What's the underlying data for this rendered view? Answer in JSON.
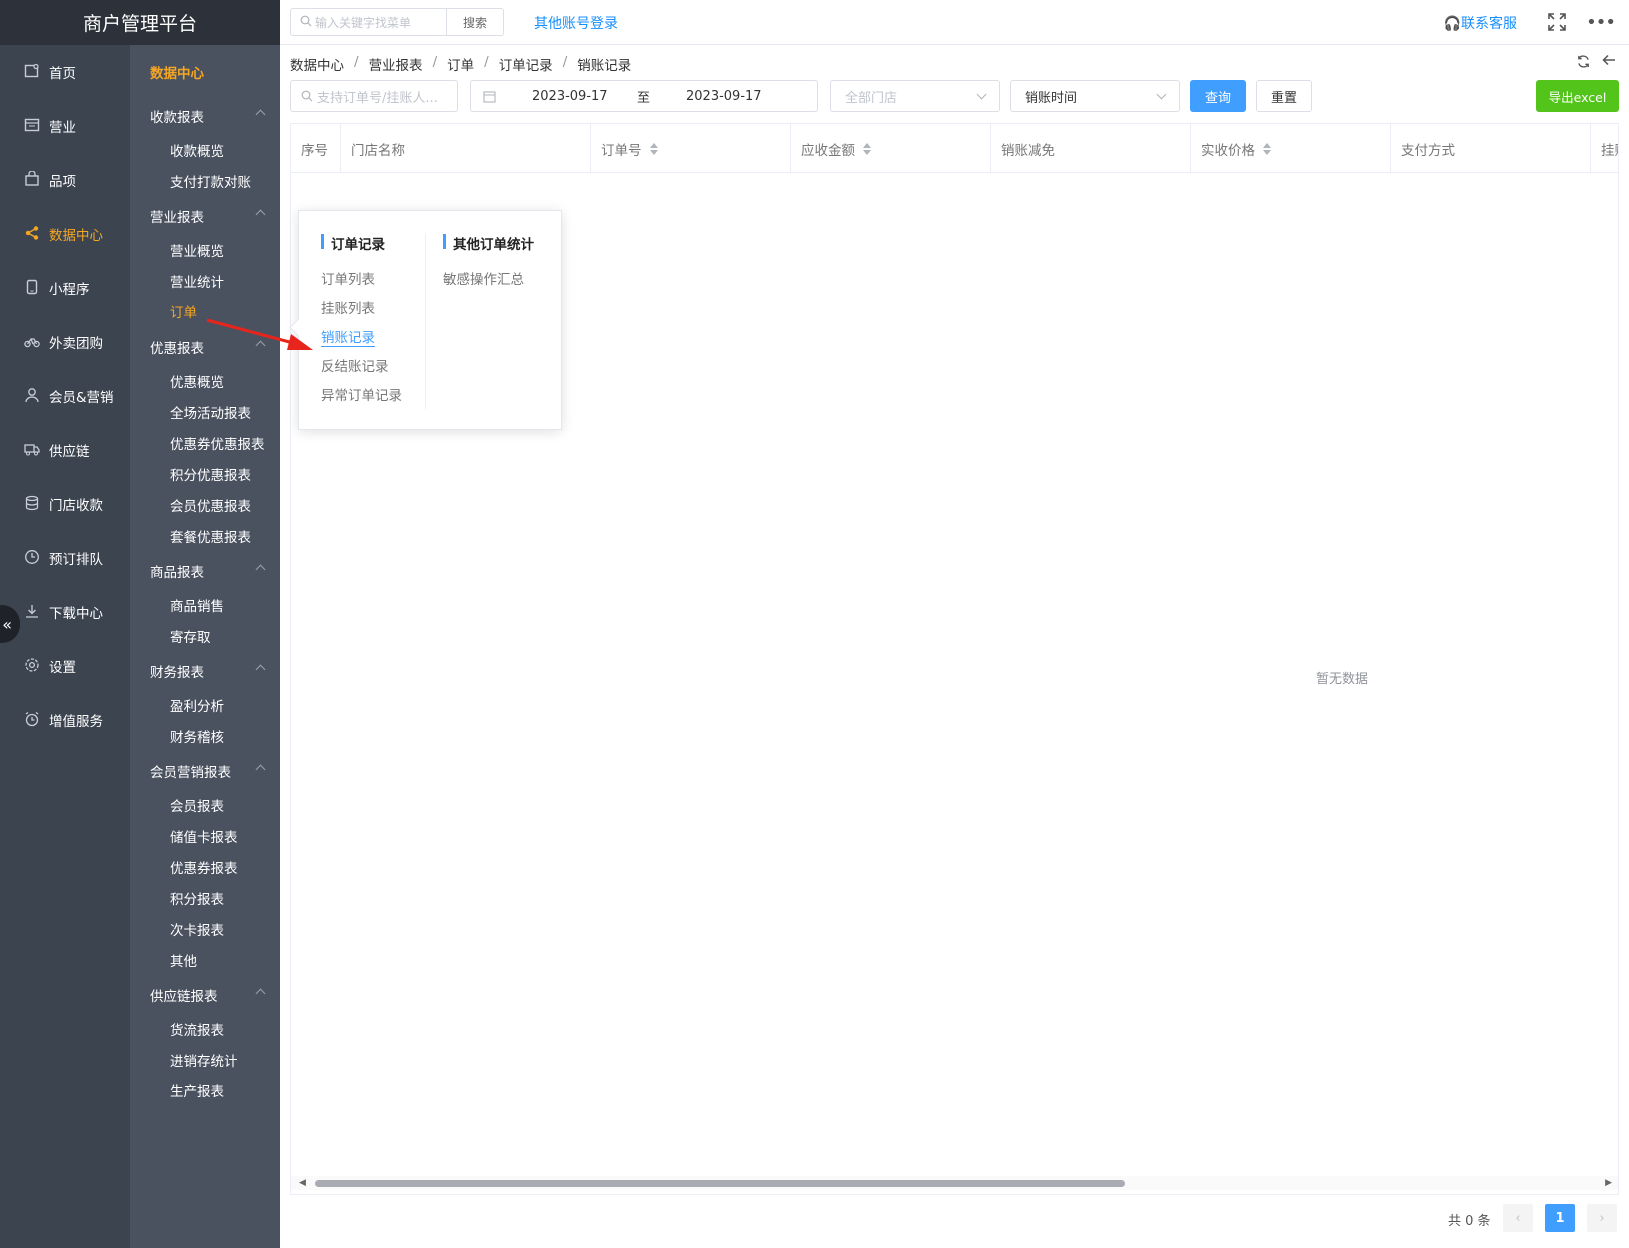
{
  "brand": "商户管理平台",
  "topbar": {
    "search_placeholder": "输入关键字找菜单",
    "search_button": "搜索",
    "other_login": "其他账号登录",
    "contact": "联系客服"
  },
  "nav": [
    {
      "label": "首页",
      "icon": "home-icon"
    },
    {
      "label": "营业",
      "icon": "calendar-icon"
    },
    {
      "label": "品项",
      "icon": "bag-icon"
    },
    {
      "label": "数据中心",
      "icon": "share-icon",
      "active": true
    },
    {
      "label": "小程序",
      "icon": "phone-icon"
    },
    {
      "label": "外卖团购",
      "icon": "bike-icon"
    },
    {
      "label": "会员&营销",
      "icon": "user-icon"
    },
    {
      "label": "供应链",
      "icon": "truck-icon"
    },
    {
      "label": "门店收款",
      "icon": "database-icon"
    },
    {
      "label": "预订排队",
      "icon": "clock-icon"
    },
    {
      "label": "下载中心",
      "icon": "download-icon"
    },
    {
      "label": "设置",
      "icon": "gear-icon"
    },
    {
      "label": "增值服务",
      "icon": "alarm-icon"
    }
  ],
  "subnav": {
    "title": "数据中心",
    "sections": [
      {
        "title": "收款报表",
        "items": [
          "收款概览",
          "支付打款对账"
        ]
      },
      {
        "title": "营业报表",
        "items": [
          "营业概览",
          "营业统计",
          "订单"
        ]
      },
      {
        "title": "优惠报表",
        "items": [
          "优惠概览",
          "全场活动报表",
          "优惠券优惠报表",
          "积分优惠报表",
          "会员优惠报表",
          "套餐优惠报表"
        ]
      },
      {
        "title": "商品报表",
        "items": [
          "商品销售",
          "寄存取"
        ]
      },
      {
        "title": "财务报表",
        "items": [
          "盈利分析",
          "财务稽核"
        ]
      },
      {
        "title": "会员营销报表",
        "items": [
          "会员报表",
          "储值卡报表",
          "优惠券报表",
          "积分报表",
          "次卡报表",
          "其他"
        ]
      },
      {
        "title": "供应链报表",
        "items": [
          "货流报表",
          "进销存统计",
          "生产报表"
        ]
      }
    ],
    "active_item": "订单"
  },
  "breadcrumb": [
    "数据中心",
    "营业报表",
    "订单",
    "订单记录",
    "销账记录"
  ],
  "filters": {
    "search_placeholder": "支持订单号/挂账人...",
    "date_start": "2023-09-17",
    "date_sep": "至",
    "date_end": "2023-09-17",
    "store_placeholder": "全部门店",
    "time_type": "销账时间",
    "query": "查询",
    "reset": "重置",
    "export": "导出excel"
  },
  "table": {
    "columns": [
      {
        "label": "序号",
        "sortable": false
      },
      {
        "label": "门店名称",
        "sortable": false
      },
      {
        "label": "订单号",
        "sortable": true
      },
      {
        "label": "应收金额",
        "sortable": true
      },
      {
        "label": "销账减免",
        "sortable": false
      },
      {
        "label": "实收价格",
        "sortable": true
      },
      {
        "label": "支付方式",
        "sortable": false
      },
      {
        "label": "挂账",
        "sortable": false
      }
    ],
    "empty_text": "暂无数据"
  },
  "pagination": {
    "total": "共 0 条",
    "current": "1"
  },
  "popover": {
    "group1": {
      "title": "订单记录",
      "items": [
        "订单列表",
        "挂账列表",
        "销账记录",
        "反结账记录",
        "异常订单记录"
      ],
      "active": "销账记录"
    },
    "group2": {
      "title": "其他订单统计",
      "items": [
        "敏感操作汇总"
      ]
    }
  },
  "colors": {
    "accent": "#409eff",
    "active_nav": "#f5a623",
    "export": "#52c41a",
    "sidebar": "#3c4450",
    "subsidebar": "#4a5260"
  }
}
